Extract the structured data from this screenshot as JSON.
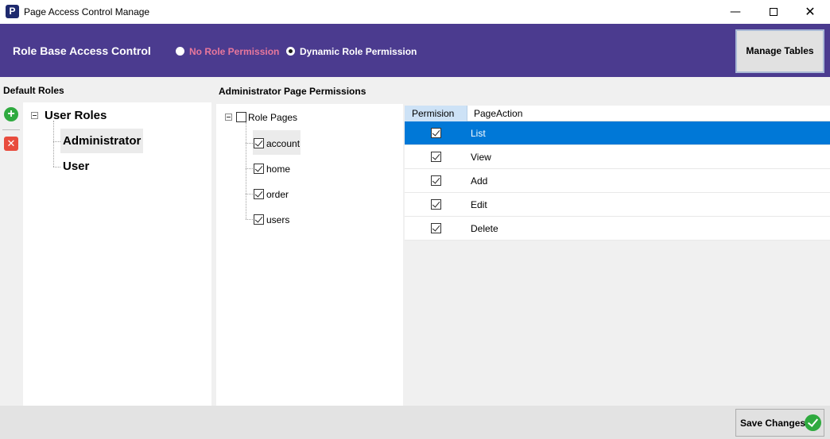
{
  "window": {
    "icon_letter": "P",
    "title": "Page Access Control Manage",
    "minimize_glyph": "—",
    "close_glyph": "✕"
  },
  "header": {
    "title": "Role Base Access Control",
    "radio_none_label": "No Role Permission",
    "radio_dynamic_label": "Dynamic Role Permission",
    "selected_mode": "Dynamic Role Permission",
    "manage_tables_label": "Manage Tables",
    "colors": {
      "band": "#4b3b8f",
      "no_role_label": "#e8779c"
    }
  },
  "roles": {
    "section_label": "Default Roles",
    "add_glyph": "+",
    "delete_glyph": "✕",
    "root_label": "User Roles",
    "items": [
      {
        "label": "Administrator",
        "selected": true
      },
      {
        "label": "User",
        "selected": false
      }
    ]
  },
  "pages": {
    "section_label": "Administrator Page Permissions",
    "root_label": "Role Pages",
    "root_checked": false,
    "items": [
      {
        "label": "account",
        "checked": true,
        "selected": true
      },
      {
        "label": "home",
        "checked": true,
        "selected": false
      },
      {
        "label": "order",
        "checked": true,
        "selected": false
      },
      {
        "label": "users",
        "checked": true,
        "selected": false
      }
    ]
  },
  "grid": {
    "columns": [
      "Permision",
      "PageAction"
    ],
    "rows": [
      {
        "action": "List",
        "permitted": true,
        "selected": true
      },
      {
        "action": "View",
        "permitted": true,
        "selected": false
      },
      {
        "action": "Add",
        "permitted": true,
        "selected": false
      },
      {
        "action": "Edit",
        "permitted": true,
        "selected": false
      },
      {
        "action": "Delete",
        "permitted": true,
        "selected": false
      }
    ],
    "selection_color": "#0078d7"
  },
  "footer": {
    "save_label": "Save Changes"
  }
}
